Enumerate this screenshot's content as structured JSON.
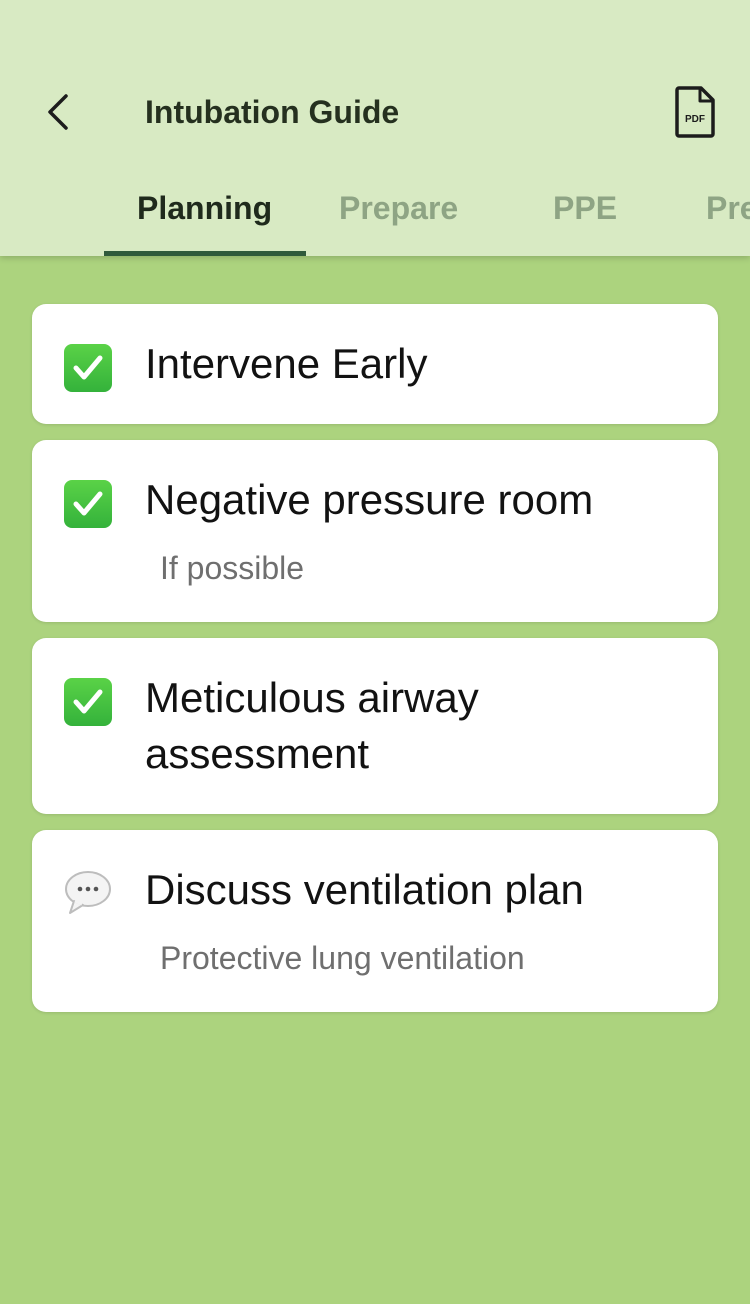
{
  "header": {
    "title": "Intubation Guide",
    "pdf_icon_label": "PDF"
  },
  "tabs": [
    {
      "label": "Planning",
      "active": true
    },
    {
      "label": "Prepare",
      "active": false
    },
    {
      "label": "PPE",
      "active": false
    },
    {
      "label": "Pre",
      "active": false
    }
  ],
  "items": [
    {
      "icon": "check-mark-icon",
      "title": "Intervene Early",
      "subtitle": ""
    },
    {
      "icon": "check-mark-icon",
      "title": "Negative pressure room",
      "subtitle": "If possible"
    },
    {
      "icon": "check-mark-icon",
      "title": "Meticulous airway assessment",
      "subtitle": ""
    },
    {
      "icon": "speech-bubble-icon",
      "title": "Discuss ventilation plan",
      "subtitle": "Protective lung ventilation"
    }
  ],
  "colors": {
    "header_bg": "#d8eac3",
    "page_bg": "#acd37e",
    "active_tab": "#1f2a1c",
    "inactive_tab": "#8ea484",
    "indicator": "#2f5a3b",
    "check_green": "#3fbf3f"
  }
}
